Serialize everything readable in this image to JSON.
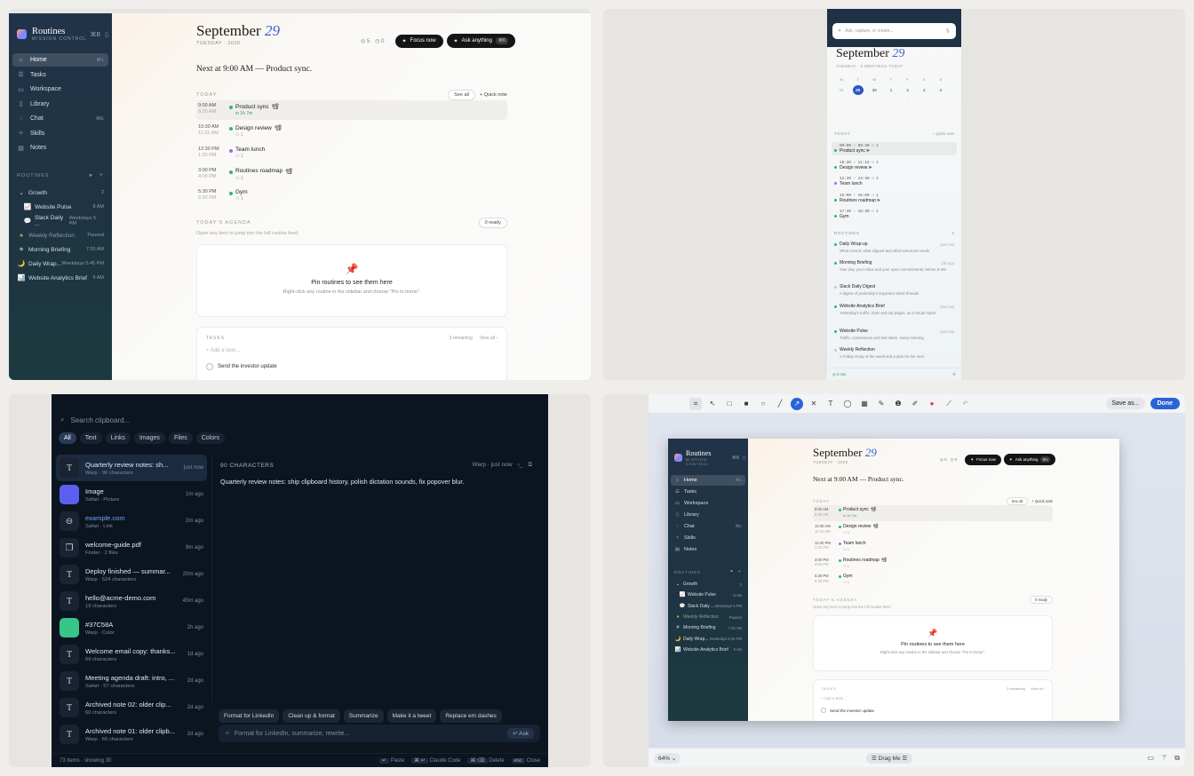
{
  "app": {
    "brand_title": "Routines",
    "brand_sub": "MISSION CONTROL",
    "brand_kbd": "⌘B",
    "nav": [
      {
        "label": "Home",
        "icon": "home-icon",
        "glyph": "⌂",
        "kbd": "⌘1"
      },
      {
        "label": "Tasks",
        "icon": "tasks-icon",
        "glyph": "☰",
        "kbd": ""
      },
      {
        "label": "Workspace",
        "icon": "workspace-icon",
        "glyph": "▭",
        "kbd": ""
      },
      {
        "label": "Library",
        "icon": "library-icon",
        "glyph": "▯",
        "kbd": ""
      },
      {
        "label": "Chat",
        "icon": "chat-icon",
        "glyph": "◌",
        "kbd": "⌘E"
      },
      {
        "label": "Skills",
        "icon": "skills-icon",
        "glyph": "✧",
        "kbd": ""
      },
      {
        "label": "Notes",
        "icon": "notes-icon",
        "glyph": "▤",
        "kbd": ""
      }
    ],
    "routines_label": "ROUTINES",
    "group": {
      "label": "Growth",
      "count": "2"
    },
    "routines": [
      {
        "label": "Website Pulse",
        "meta": "8 AM",
        "glyph": "📈",
        "indent": true
      },
      {
        "label": "Slack Daily ...",
        "meta": "Weekdays 5 PM",
        "glyph": "💬",
        "indent": true
      },
      {
        "label": "Weekly Reflection",
        "meta": "Paused",
        "glyph": "●",
        "indent": false,
        "paused": true
      },
      {
        "label": "Morning Briefing",
        "meta": "7:30 AM",
        "glyph": "☀",
        "indent": false
      },
      {
        "label": "Daily Wrap...",
        "meta": "Weekdays 5:45 PM",
        "glyph": "🌙",
        "indent": false
      },
      {
        "label": "Website Analytics Brief",
        "meta": "9 AM",
        "glyph": "📊",
        "indent": false
      }
    ],
    "date_month": "September",
    "date_day": "29",
    "date_sub": "TUESDAY · 2026",
    "stat_done": "◎ 5",
    "stat_clock": "◷ 0",
    "focus_label": "Focus now",
    "ask_label": "Ask anything",
    "ask_kbd": "⌘K",
    "next_line": "Next at 9:00 AM — Product sync.",
    "today_label": "TODAY",
    "see_all": "See all",
    "quick_note": "+ Quick note",
    "events": [
      {
        "start": "9:00 AM",
        "end": "9:30 AM",
        "title": "Product sync",
        "sub": "in 1h 7m",
        "color": "#2eb67d",
        "cam": "📽",
        "live": true
      },
      {
        "start": "10:30 AM",
        "end": "11:15 AM",
        "title": "Design review",
        "sub": "⚇ 1",
        "color": "#2eb67d",
        "cam": "📽",
        "live": false
      },
      {
        "start": "12:30 PM",
        "end": "1:30 PM",
        "title": "Team lunch",
        "sub": "⚇ 1",
        "color": "#9b6ee8",
        "cam": "",
        "live": false
      },
      {
        "start": "3:00 PM",
        "end": "4:00 PM",
        "title": "Routines roadmap",
        "sub": "⚇ 1",
        "color": "#2eb67d",
        "cam": "📽",
        "live": false
      },
      {
        "start": "5:30 PM",
        "end": "6:30 PM",
        "title": "Gym",
        "sub": "⚇ 1",
        "color": "#2eb67d",
        "cam": "",
        "live": false
      }
    ],
    "agenda_label": "TODAY'S AGENDA",
    "agenda_chip": "0 ready",
    "agenda_note": "Open any item to jump into the full routine feed.",
    "pin_title": "Pin routines to see them here",
    "pin_sub": "Right-click any routine in the sidebar and choose \"Pin to home\".",
    "tasks_label": "TASKS",
    "tasks_remaining": "3 remaining",
    "tasks_view_all": "View all ›",
    "tasks_add": "+ Add a task...",
    "task1": "Send the investor update"
  },
  "mobile": {
    "search_placeholder": "Ask, capture, or create...",
    "date_month": "September",
    "date_day": "29",
    "date_sub": "TUESDAY · 5 MEETINGS TODAY",
    "dow": [
      "M",
      "T",
      "W",
      "T",
      "F",
      "S",
      "S"
    ],
    "days": [
      "28",
      "29",
      "30",
      "1",
      "2",
      "3",
      "4"
    ],
    "today_label": "TODAY",
    "quick_note": "+ Quick note",
    "events": [
      {
        "time": "09:00 – 09:30 ⚇ 1",
        "name": "Product sync ⌱",
        "color": "#2eb67d"
      },
      {
        "time": "10:30 – 11:15 ⚇ 1",
        "name": "Design review ⌱",
        "color": "#2eb67d"
      },
      {
        "time": "12:30 – 13:30 ⚇ 1",
        "name": "Team lunch",
        "color": "#9b6ee8"
      },
      {
        "time": "15:00 – 16:00 ⚇ 1",
        "name": "Routines roadmap ⌱",
        "color": "#2eb67d"
      },
      {
        "time": "17:30 – 18:30 ⚇ 1",
        "name": "Gym",
        "color": "#2eb67d"
      }
    ],
    "routines_label": "ROUTINES",
    "routines_count": "6",
    "routines": [
      {
        "name": "Daily Wrap-up",
        "time": "just now",
        "desc": "What moved, what slipped and what tomorrow needs",
        "color": "#2eb67d"
      },
      {
        "name": "Morning Briefing",
        "time": "13h ago",
        "desc": "Your day, your inbox and your open commitments, before 8 AM",
        "color": "#2eb67d"
      },
      {
        "name": "Slack Daily Digest",
        "time": "",
        "desc": "A digest of yesterday's important Slack threads",
        "color": "#c9c9c9"
      },
      {
        "name": "Website Analytics Brief",
        "time": "just now",
        "desc": "Yesterday's traffic, trials and top pages, as a visual report",
        "color": "#2eb67d"
      },
      {
        "name": "Website Pulse",
        "time": "just now",
        "desc": "Traffic, conversions and trial starts, every morning",
        "color": "#2eb67d"
      },
      {
        "name": "Weekly Reflection",
        "time": "",
        "desc": "A Friday recap of the week and a plan for the next",
        "color": "#c9c9c9"
      }
    ],
    "footer_left": "◎ 5 ran",
    "footer_right": "⚙"
  },
  "clipboard": {
    "search_placeholder": "Search clipboard...",
    "tabs": [
      "All",
      "Text",
      "Links",
      "Images",
      "Files",
      "Colors"
    ],
    "items": [
      {
        "title": "Quarterly review notes: sh...",
        "sub": "Warp · 90 characters",
        "ago": "just now",
        "thumb": "T",
        "kind": "text"
      },
      {
        "title": "Image",
        "sub": "Safari · Picture",
        "ago": "1m ago",
        "thumb": "",
        "kind": "image",
        "color": "#5b5ff0"
      },
      {
        "title": "example.com",
        "sub": "Safari · Link",
        "ago": "2m ago",
        "thumb": "⊖",
        "kind": "link"
      },
      {
        "title": "welcome-guide.pdf",
        "sub": "Finder · 2 files",
        "ago": "8m ago",
        "thumb": "❐",
        "kind": "file"
      },
      {
        "title": "Deploy finished — summar...",
        "sub": "Warp · 524 characters",
        "ago": "20m ago",
        "thumb": "T",
        "kind": "text"
      },
      {
        "title": "hello@acme-demo.com",
        "sub": "19 characters",
        "ago": "45m ago",
        "thumb": "T",
        "kind": "text"
      },
      {
        "title": "#37C58A",
        "sub": "Warp · Color",
        "ago": "2h ago",
        "thumb": "",
        "kind": "color",
        "color": "#37c58a"
      },
      {
        "title": "Welcome email copy: thanks...",
        "sub": "69 characters",
        "ago": "1d ago",
        "thumb": "T",
        "kind": "text"
      },
      {
        "title": "Meeting agenda draft: intro, ...",
        "sub": "Safari · 57 characters",
        "ago": "2d ago",
        "thumb": "T",
        "kind": "text"
      },
      {
        "title": "Archived note 02: older clip...",
        "sub": "60 characters",
        "ago": "2d ago",
        "thumb": "T",
        "kind": "text"
      },
      {
        "title": "Archived note 01: older clipb...",
        "sub": "Warp · 60 characters",
        "ago": "2d ago",
        "thumb": "T",
        "kind": "text"
      }
    ],
    "detail_header": "90 CHARACTERS",
    "detail_source": "Warp · just now",
    "detail_body": "Quarterly review notes: ship clipboard history, polish dictation sounds, fix popover blur.",
    "actions": [
      "Format for LinkedIn",
      "Clean up & format",
      "Summarize",
      "Make it a tweet",
      "Replace em dashes"
    ],
    "ask_placeholder": "Format for LinkedIn, summarize, rewrite...",
    "ask_btn": "↵ Ask",
    "status_left": "73 items · showing 30",
    "status_hints": [
      {
        "k": "↵",
        "l": "Paste"
      },
      {
        "k": "⌘ ↵",
        "l": "Claude Code"
      },
      {
        "k": "⌘ ⌫",
        "l": "Delete"
      },
      {
        "k": "esc",
        "l": "Close"
      }
    ]
  },
  "annotator": {
    "tools": [
      {
        "name": "crop-tool",
        "glyph": "⌗"
      },
      {
        "name": "select-tool",
        "glyph": "↖"
      },
      {
        "name": "rectangle-tool",
        "glyph": "□"
      },
      {
        "name": "filled-rect-tool",
        "glyph": "■"
      },
      {
        "name": "ellipse-tool",
        "glyph": "○"
      },
      {
        "name": "line-tool",
        "glyph": "╱"
      },
      {
        "name": "arrow-tool",
        "glyph": "↗"
      },
      {
        "name": "cross-tool",
        "glyph": "✕"
      },
      {
        "name": "text-tool",
        "glyph": "T"
      },
      {
        "name": "bubble-tool",
        "glyph": "◯"
      },
      {
        "name": "grid-tool",
        "glyph": "▦"
      },
      {
        "name": "highlight-tool",
        "glyph": "✎"
      },
      {
        "name": "counter-tool",
        "glyph": "❶"
      },
      {
        "name": "pen-tool",
        "glyph": "✐"
      },
      {
        "name": "color-swatch",
        "glyph": "●"
      },
      {
        "name": "stroke-tool",
        "glyph": "⟋"
      },
      {
        "name": "undo-tool",
        "glyph": "↶"
      }
    ],
    "save_label": "Save as...",
    "done_label": "Done",
    "zoom": "64% ⌄",
    "drag_label": "☰  Drag Me  ☰",
    "accent": "#2a64d8"
  }
}
